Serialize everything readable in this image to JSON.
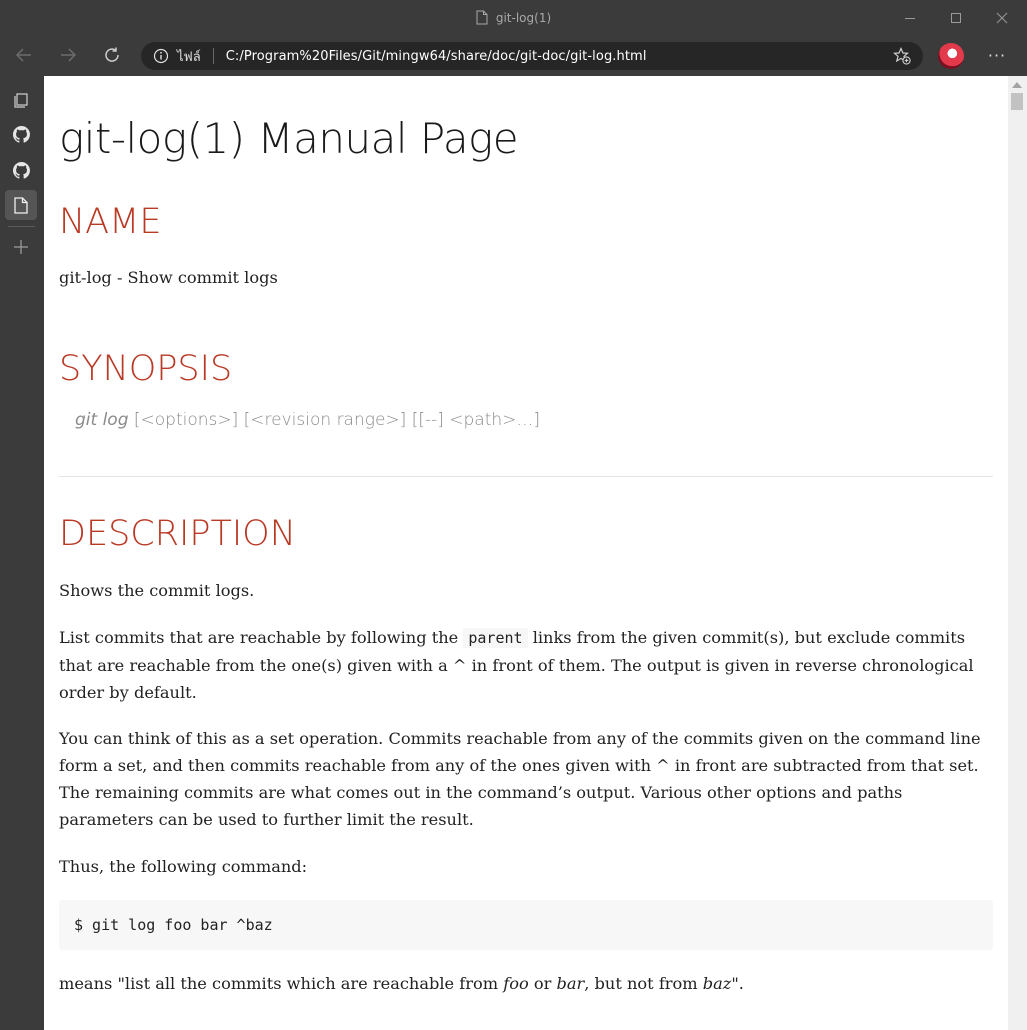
{
  "window": {
    "title": "git-log(1)"
  },
  "addressbar": {
    "scheme_label": "ไฟล์",
    "url": "C:/Program%20Files/Git/mingw64/share/doc/git-doc/git-log.html"
  },
  "toolbar": {
    "more_label": "···"
  },
  "sidebar": {
    "items": [
      {
        "icon": "tab-actions-icon"
      },
      {
        "icon": "github-icon"
      },
      {
        "icon": "github-icon"
      },
      {
        "icon": "file-icon",
        "active": true
      },
      {
        "icon": "plus-icon"
      }
    ]
  },
  "document": {
    "title": "git-log(1) Manual Page",
    "name_heading": "NAME",
    "name_text": "git-log - Show commit logs",
    "synopsis_heading": "SYNOPSIS",
    "synopsis_cmd": "git log",
    "synopsis_args": " [<options>] [<revision range>] [[--] <path>…​]",
    "description_heading": "DESCRIPTION",
    "p1": "Shows the commit logs.",
    "p2_before": "List commits that are reachable by following the ",
    "p2_code": "parent",
    "p2_after": " links from the given commit(s), but exclude commits that are reachable from the one(s) given with a ^ in front of them. The output is given in reverse chronological order by default.",
    "p3": "You can think of this as a set operation. Commits reachable from any of the commits given on the command line form a set, and then commits reachable from any of the ones given with ^ in front are subtracted from that set. The remaining commits are what comes out in the command’s output. Various other options and paths parameters can be used to further limit the result.",
    "p4": "Thus, the following command:",
    "code_example": "$ git log foo bar ^baz",
    "p5_a": "means \"list all the commits which are reachable from ",
    "p5_foo": "foo",
    "p5_b": " or ",
    "p5_bar": "bar",
    "p5_c": ", but not from ",
    "p5_baz": "baz",
    "p5_d": "\"."
  },
  "colors": {
    "heading_accent": "#ba3925",
    "chrome_bg": "#3b3b3b",
    "address_bg": "#262626"
  }
}
